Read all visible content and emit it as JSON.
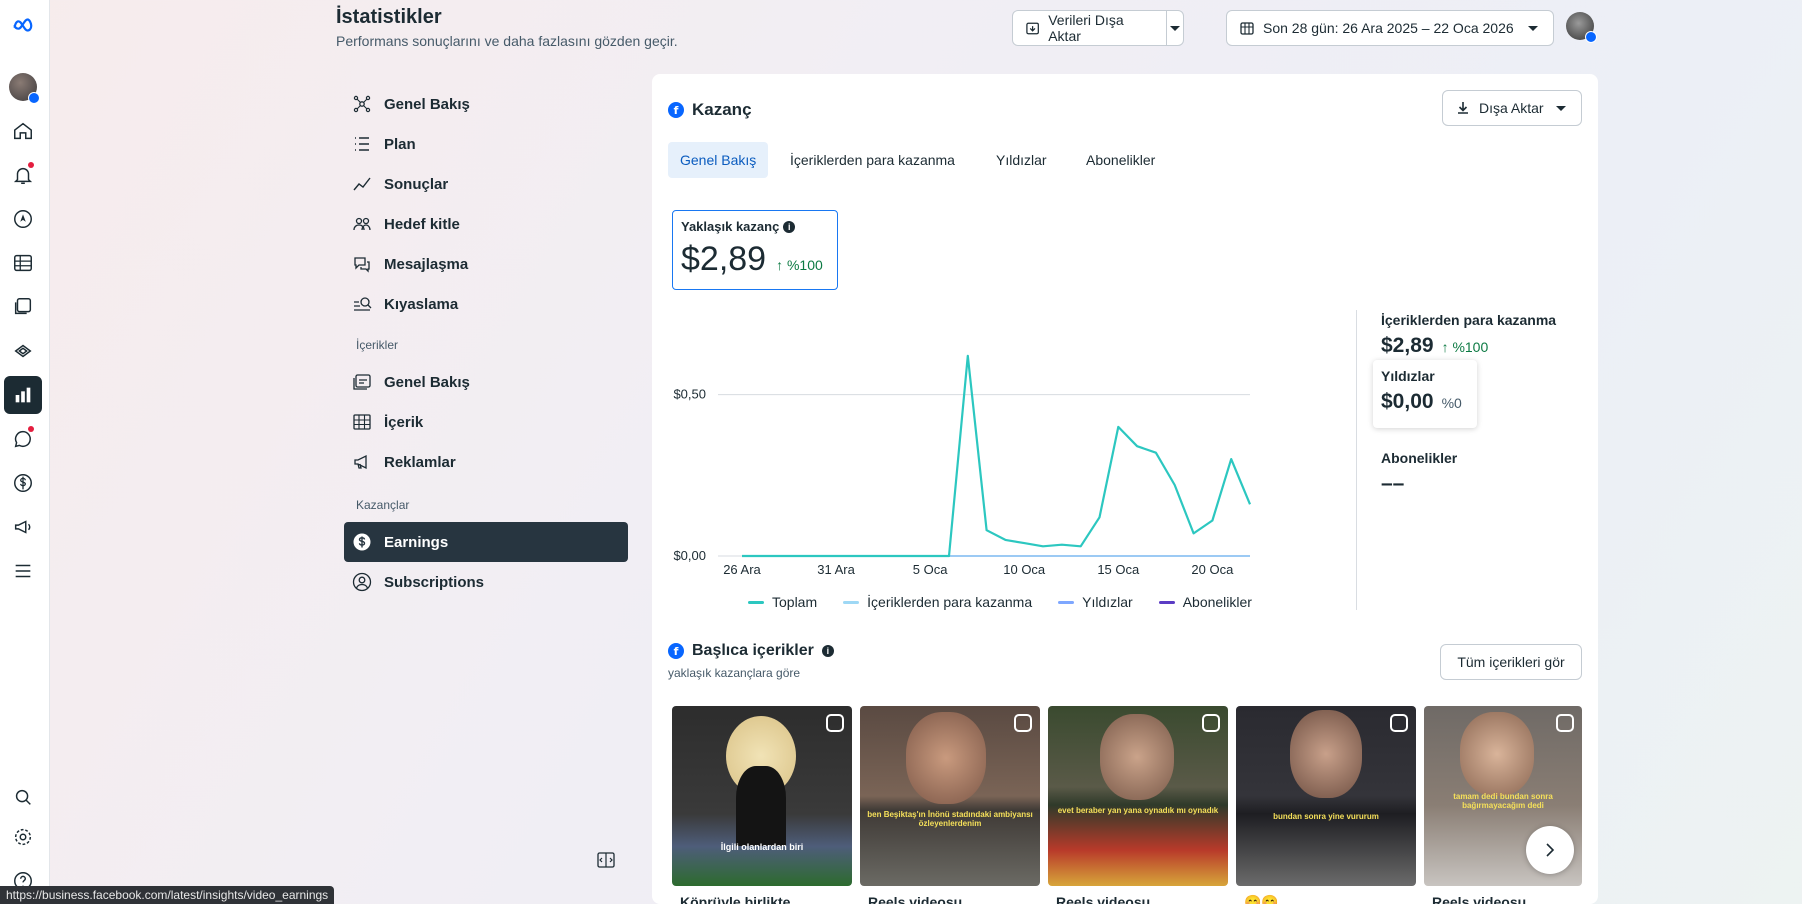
{
  "header": {
    "title": "İstatistikler",
    "subtitle": "Performans sonuçlarını ve daha fazlasını gözden geçir.",
    "export_label": "Verileri Dışa Aktar",
    "date_range": "Son 28 gün: 26 Ara 2025 – 22 Oca 2026"
  },
  "nav": {
    "items": [
      {
        "label": "Genel Bakış"
      },
      {
        "label": "Plan"
      },
      {
        "label": "Sonuçlar"
      },
      {
        "label": "Hedef kitle"
      },
      {
        "label": "Mesajlaşma"
      },
      {
        "label": "Kıyaslama"
      }
    ],
    "section_contents": "İçerikler",
    "content_items": [
      {
        "label": "Genel Bakış"
      },
      {
        "label": "İçerik"
      },
      {
        "label": "Reklamlar"
      }
    ],
    "section_earnings": "Kazançlar",
    "earnings_items": [
      {
        "label": "Earnings"
      },
      {
        "label": "Subscriptions"
      }
    ]
  },
  "card": {
    "title": "Kazanç",
    "export_label": "Dışa Aktar",
    "tabs": [
      {
        "label": "Genel Bakış"
      },
      {
        "label": "İçeriklerden para kazanma"
      },
      {
        "label": "Yıldızlar"
      },
      {
        "label": "Abonelikler"
      }
    ],
    "kpi": {
      "label": "Yaklaşık kazanç",
      "value": "$2,89",
      "change": "↑ %100"
    },
    "right_panel": {
      "monetization_label": "İçeriklerden para kazanma",
      "monetization_value": "$2,89",
      "monetization_change": "↑ %100",
      "stars_label": "Yıldızlar",
      "stars_value": "$0,00",
      "stars_change": "%0",
      "subs_label": "Abonelikler",
      "subs_value": "––"
    },
    "top_content": {
      "title": "Başlıca içerikler",
      "subtitle": "yaklaşık kazançlara göre",
      "see_all": "Tüm içerikleri gör",
      "items": [
        {
          "caption": "Köprüyle birlikte",
          "overlay": "İlgili olanlardan biri"
        },
        {
          "caption": "Reels videosu",
          "overlay": "ben Beşiktaş'ın İnönü stadındaki ambiyansı özleyenlerdenim"
        },
        {
          "caption": "Reels videosu",
          "overlay": "evet beraber yan yana oynadık mı oynadık"
        },
        {
          "caption": "😊😊",
          "overlay": "bundan sonra yine vururum"
        },
        {
          "caption": "Reels videosu",
          "overlay": "tamam dedi bundan sonra bağırmayacağım dedi"
        }
      ]
    }
  },
  "colors": {
    "total": "#2cc7c0",
    "monetization": "#9ed8f5",
    "stars": "#7ea7ff",
    "subscriptions": "#5b3cc4"
  },
  "status_url": "https://business.facebook.com/latest/insights/video_earnings",
  "chart_data": {
    "type": "line",
    "x": [
      "26 Ara",
      "27 Ara",
      "28 Ara",
      "29 Ara",
      "30 Ara",
      "31 Ara",
      "1 Oca",
      "2 Oca",
      "3 Oca",
      "4 Oca",
      "5 Oca",
      "6 Oca",
      "7 Oca",
      "8 Oca",
      "9 Oca",
      "10 Oca",
      "11 Oca",
      "12 Oca",
      "13 Oca",
      "14 Oca",
      "15 Oca",
      "16 Oca",
      "17 Oca",
      "18 Oca",
      "19 Oca",
      "20 Oca",
      "21 Oca",
      "22 Oca"
    ],
    "tick_labels": [
      "26 Ara",
      "31 Ara",
      "5 Oca",
      "10 Oca",
      "15 Oca",
      "20 Oca"
    ],
    "y_ticks": [
      "$0,00",
      "$0,50"
    ],
    "ylim": [
      0,
      0.7
    ],
    "series": [
      {
        "name": "Toplam",
        "values": [
          0,
          0,
          0,
          0,
          0,
          0,
          0,
          0,
          0,
          0,
          0,
          0,
          0.62,
          0.08,
          0.05,
          0.04,
          0.03,
          0.035,
          0.03,
          0.12,
          0.4,
          0.34,
          0.32,
          0.22,
          0.07,
          0.11,
          0.3,
          0.16
        ]
      },
      {
        "name": "İçeriklerden para kazanma",
        "values": [
          0,
          0,
          0,
          0,
          0,
          0,
          0,
          0,
          0,
          0,
          0,
          0,
          0,
          0,
          0,
          0,
          0,
          0,
          0,
          0,
          0,
          0,
          0,
          0,
          0,
          0,
          0,
          0
        ]
      },
      {
        "name": "Yıldızlar",
        "values": [
          0,
          0,
          0,
          0,
          0,
          0,
          0,
          0,
          0,
          0,
          0,
          0,
          0,
          0,
          0,
          0,
          0,
          0,
          0,
          0,
          0,
          0,
          0,
          0,
          0,
          0,
          0,
          0
        ]
      },
      {
        "name": "Abonelikler",
        "values": [
          0,
          0,
          0,
          0,
          0,
          0,
          0,
          0,
          0,
          0,
          0,
          0,
          0,
          0,
          0,
          0,
          0,
          0,
          0,
          0,
          0,
          0,
          0,
          0,
          0,
          0,
          0,
          0
        ]
      }
    ],
    "legend_position": "bottom",
    "grid": true
  }
}
